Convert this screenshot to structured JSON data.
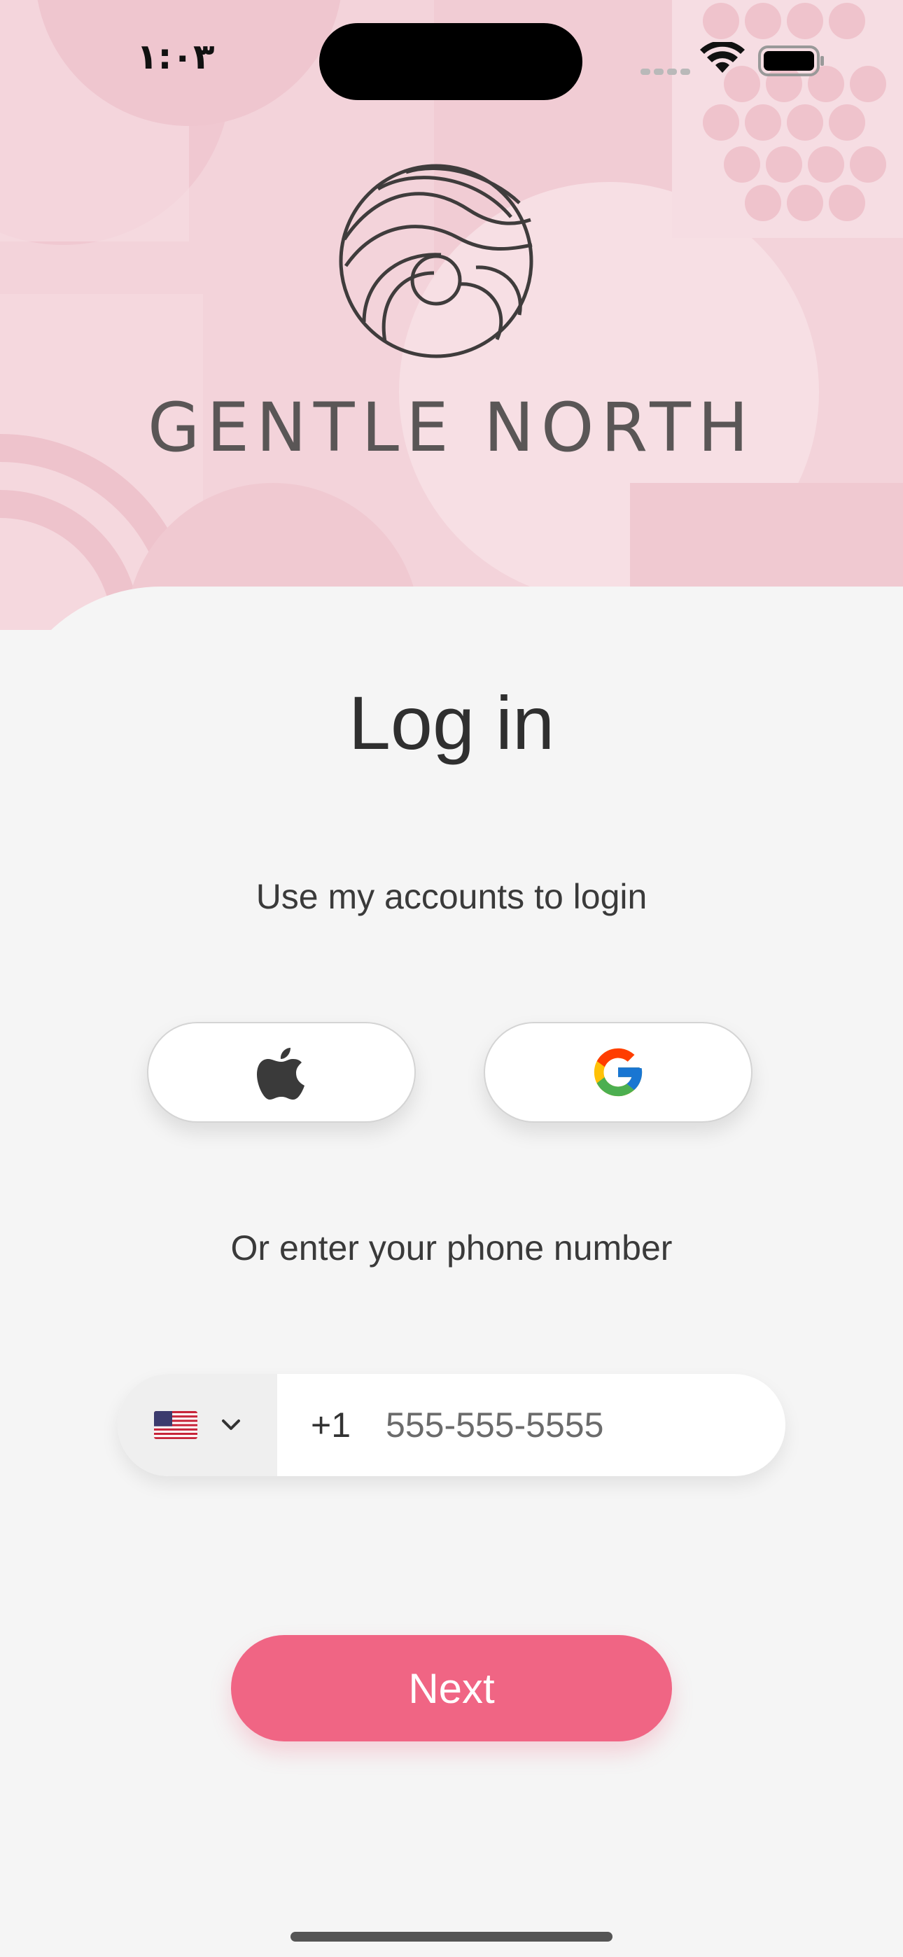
{
  "status_bar": {
    "time": "١:٠٣",
    "icons": [
      "signal-icon",
      "wifi-icon",
      "battery-icon"
    ]
  },
  "brand": {
    "name": "GENTLE NORTH",
    "logo_icon": "wave-circle-logo"
  },
  "login": {
    "title": "Log in",
    "accounts_prompt": "Use my accounts to login",
    "social_buttons": [
      {
        "icon": "apple-icon"
      },
      {
        "icon": "google-icon"
      }
    ],
    "phone_prompt": "Or enter your phone number",
    "country_flag": "us-flag-icon",
    "dial_code": "+1",
    "phone_placeholder": "555-555-5555",
    "next_label": "Next"
  },
  "colors": {
    "hero_background": "#f3d3da",
    "accent": "#f06584",
    "sheet_background": "#f5f5f5"
  }
}
